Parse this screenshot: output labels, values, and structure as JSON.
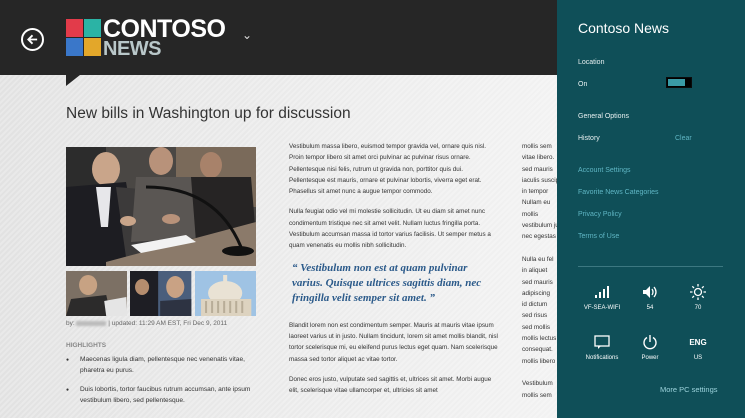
{
  "app": {
    "brand_top": "CONTOSO",
    "brand_bottom": "NEWS",
    "headline": "New bills in Washington up for discussion",
    "byline_prefix": "by:",
    "byline_updated": "| updated: 11:29 AM EST, Fri Dec 9, 2011",
    "highlights_title": "HIGHLIGHTS",
    "highlights": [
      "Maecenas ligula diam, pellentesque nec venenatis vitae, pharetra eu purus.",
      "Duis lobortis, tortor faucibus rutrum accumsan, ante ipsum vestibulum libero, sed pellentesque."
    ],
    "col2": {
      "p1": "Vestibulum massa libero, euismod tempor gravida vel, ornare quis nisl. Proin tempor libero sit amet orci pulvinar ac pulvinar risus ornare. Pellentesque nisi felis, rutrum ut gravida non, porttitor quis dui. Pellentesque est mauris, ornare et pulvinar lobortis, viverra eget erat. Phasellus sit amet nunc a augue tempor commodo.",
      "p2": "Nulla feugiat odio vel mi molestie sollicitudin. Ut eu diam sit amet nunc condimentum tristique nec sit amet velit. Nullam luctus fringilla porta. Vestibulum accumsan massa id tortor varius facilisis. Ut semper metus a quam venenatis eu mollis nibh sollicitudin.",
      "quote": "“ Vestibulum non est at quam pulvinar varius. Quisque ultrices sagittis diam, nec fringilla velit semper sit amet. ”",
      "p3": "Blandit lorem non est condimentum semper. Mauris at mauris vitae ipsum laoreet varius ut in justo. Nullam tincidunt, lorem sit amet mollis blandit, nisl tortor scelerisque mi, eu eleifend purus lectus eget quam. Nam scelerisque massa sed tortor aliquet ac vitae tortor.",
      "p4": "Donec eros justo, vulputate sed sagittis et, ultrices sit amet. Morbi augue elit, scelerisque vitae ullamcorper et, ultricies sit amet"
    },
    "col3_lines": [
      "mollis sem",
      "vitae libero.",
      "sed mauris",
      "iaculis suscipit",
      "in tempor",
      "Nullam eu",
      "mollis",
      "vestibulum justo",
      "nec egestas",
      "",
      "Nulla eu fel",
      "in aliquet",
      "sed mauris",
      "adipiscing",
      "id dictum",
      "sed risus",
      "sed mollis",
      "mollis lectus",
      "consequat.",
      "mollis libero",
      "",
      "Vestibulum",
      "mollis sem"
    ]
  },
  "charm": {
    "title": "Contoso News",
    "location_label": "Location",
    "location_value": "On",
    "general_label": "General Options",
    "history_label": "History",
    "clear_label": "Clear",
    "links": [
      "Account Settings",
      "Favorite News Categories",
      "Privacy Policy",
      "Terms of Use"
    ],
    "system": [
      {
        "icon": "wifi-icon",
        "caption": "VF-SEA-WIFI"
      },
      {
        "icon": "volume-icon",
        "caption": "54"
      },
      {
        "icon": "brightness-icon",
        "caption": "70"
      },
      {
        "icon": "notifications-icon",
        "caption": "Notifications"
      },
      {
        "icon": "power-icon",
        "caption": "Power"
      },
      {
        "icon": "keyboard-language-icon",
        "caption": "US",
        "label": "ENG"
      }
    ],
    "more_label": "More PC settings"
  },
  "colors": {
    "charm_bg": "#0f4f58",
    "topbar_bg": "#262626",
    "link_color": "#5fb6c4",
    "quote_color": "#2b5a8a"
  }
}
